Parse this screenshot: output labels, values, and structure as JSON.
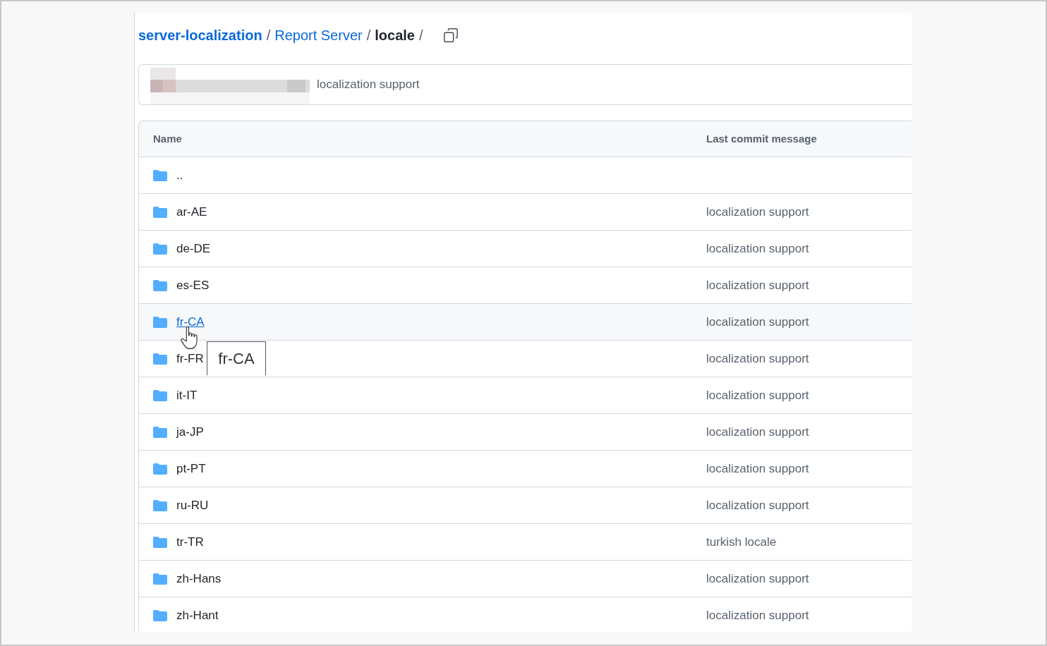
{
  "breadcrumb": [
    {
      "label": "server-localization",
      "kind": "repo",
      "separator": "/"
    },
    {
      "label": "Report Server",
      "kind": "link",
      "separator": "/"
    },
    {
      "label": "locale",
      "kind": "current",
      "separator": "/"
    }
  ],
  "latest_commit": {
    "message": "localization support"
  },
  "table": {
    "columns": [
      "Name",
      "Last commit message"
    ],
    "rows": [
      {
        "name": "..",
        "hovered": false
      },
      {
        "name": "ar-AE",
        "message": "localization support",
        "hovered": false
      },
      {
        "name": "de-DE",
        "message": "localization support",
        "hovered": false
      },
      {
        "name": "es-ES",
        "message": "localization support",
        "hovered": false
      },
      {
        "name": "fr-CA",
        "message": "localization support",
        "hovered": true,
        "tooltip": "fr-CA"
      },
      {
        "name": "fr-FR",
        "message": "localization support",
        "hovered": false
      },
      {
        "name": "it-IT",
        "message": "localization support",
        "hovered": false
      },
      {
        "name": "ja-JP",
        "message": "localization support",
        "hovered": false
      },
      {
        "name": "pt-PT",
        "message": "localization support",
        "hovered": false
      },
      {
        "name": "ru-RU",
        "message": "localization support",
        "hovered": false
      },
      {
        "name": "tr-TR",
        "message": "turkish locale",
        "hovered": false
      },
      {
        "name": "zh-Hans",
        "message": "localization support",
        "hovered": false
      },
      {
        "name": "zh-Hant",
        "message": "localization support",
        "hovered": false
      }
    ]
  }
}
